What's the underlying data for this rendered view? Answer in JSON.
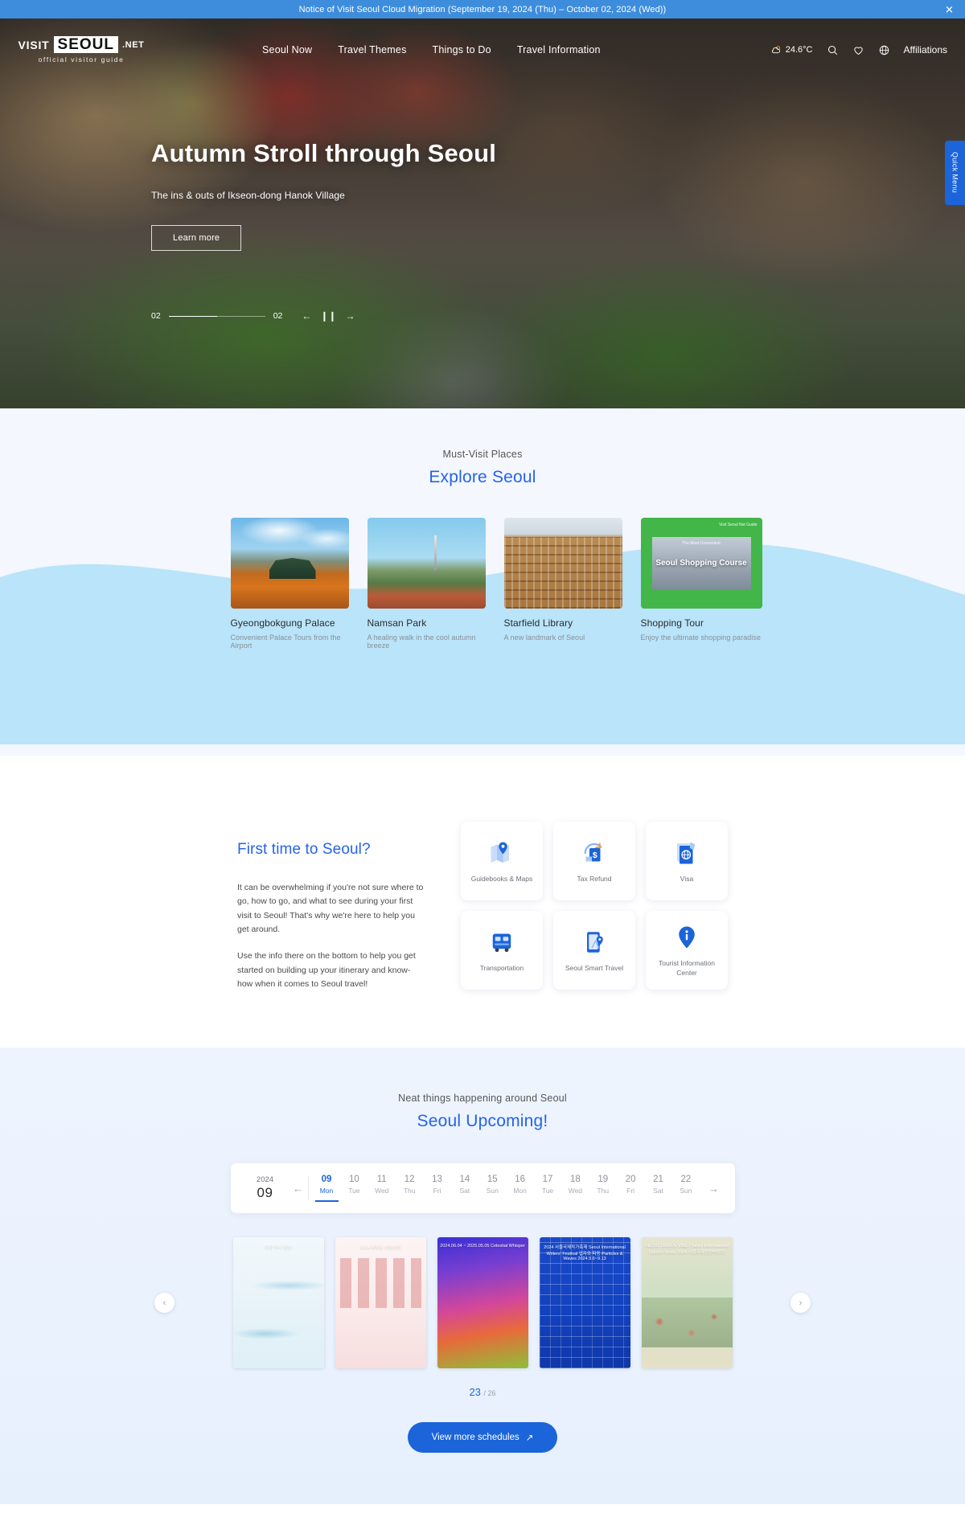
{
  "notice": {
    "text": "Notice of Visit Seoul Cloud Migration (September 19, 2024 (Thu) – October 02, 2024 (Wed))",
    "close_label": "✕"
  },
  "header": {
    "logo": {
      "visit": "VISIT",
      "seoul": "SEOUL",
      "net": ".NET",
      "tagline": "official visitor guide"
    },
    "nav": [
      {
        "label": "Seoul Now"
      },
      {
        "label": "Travel Themes"
      },
      {
        "label": "Things to Do"
      },
      {
        "label": "Travel Information"
      }
    ],
    "weather": "24.6°C",
    "affiliations": "Affiliations",
    "icons": [
      "weather-icon",
      "search-icon",
      "heart-icon",
      "globe-icon"
    ]
  },
  "quick_menu": {
    "label": "Quick Menu"
  },
  "hero": {
    "title": "Autumn Stroll through Seoul",
    "subtitle": "The ins & outs of Ikseon-dong Hanok Village",
    "button": "Learn more",
    "slide_current": "02",
    "slide_total": "02"
  },
  "explore": {
    "eyebrow": "Must-Visit Places",
    "title": "Explore Seoul",
    "cards": [
      {
        "title": "Gyeongbokgung Palace",
        "desc": "Convenient Palace Tours from the Airport"
      },
      {
        "title": "Namsan Park",
        "desc": "A healing walk in the cool autumn breeze"
      },
      {
        "title": "Starfield Library",
        "desc": "A new landmark of Seoul"
      },
      {
        "title": "Shopping Tour",
        "desc": "Enjoy the ultimate shopping paradise",
        "overlay_label": "Seoul Shopping Course",
        "overlay_top": "The Most Convenient",
        "badge": "Visit Seoul\nNet Guide"
      }
    ]
  },
  "firsttime": {
    "title": "First time to Seoul?",
    "paragraph1": "It can be overwhelming if you're not sure where to go, how to go, and what to see during your first visit to Seoul! That's why we're here to help you get around.",
    "paragraph2": "Use the info there on the bottom to help you get started on building up your itinerary and know-how when it comes to Seoul travel!",
    "items": [
      {
        "label": "Guidebooks & Maps",
        "icon": "map-pin-icon"
      },
      {
        "label": "Tax Refund",
        "icon": "tax-refund-icon"
      },
      {
        "label": "Visa",
        "icon": "passport-globe-icon"
      },
      {
        "label": "Transportation",
        "icon": "bus-icon"
      },
      {
        "label": "Seoul Smart Travel",
        "icon": "smartphone-pin-icon"
      },
      {
        "label": "Tourist Information Center",
        "icon": "info-pin-icon"
      }
    ]
  },
  "upcoming": {
    "eyebrow": "Neat things happening around Seoul",
    "title": "Seoul Upcoming!",
    "calendar": {
      "year": "2024",
      "month": "09",
      "prev_arrow": "←",
      "next_arrow": "→",
      "days": [
        {
          "num": "09",
          "label": "Mon",
          "active": true
        },
        {
          "num": "10",
          "label": "Tue",
          "active": false
        },
        {
          "num": "11",
          "label": "Wed",
          "active": false
        },
        {
          "num": "12",
          "label": "Thu",
          "active": false
        },
        {
          "num": "13",
          "label": "Fri",
          "active": false
        },
        {
          "num": "14",
          "label": "Sat",
          "active": false
        },
        {
          "num": "15",
          "label": "Sun",
          "active": false
        },
        {
          "num": "16",
          "label": "Mon",
          "active": false
        },
        {
          "num": "17",
          "label": "Tue",
          "active": false
        },
        {
          "num": "18",
          "label": "Wed",
          "active": false
        },
        {
          "num": "19",
          "label": "Thu",
          "active": false
        },
        {
          "num": "20",
          "label": "Fri",
          "active": false
        },
        {
          "num": "21",
          "label": "Sat",
          "active": false
        },
        {
          "num": "22",
          "label": "Sun",
          "active": false
        }
      ]
    },
    "posters": [
      {
        "caption": "한강 역사 탐방",
        "art": "p1"
      },
      {
        "caption": "2024 태권도 상설공연",
        "art": "p2"
      },
      {
        "caption": "2024.06.04 ~ 2025.05.05 Celestial Whisper",
        "art": "p3"
      },
      {
        "caption": "2024 서울국제작가축제 Seoul International Writers' Festival 입자와 파동 Particles & Waves 2024.9.6~9.13",
        "art": "p4"
      },
      {
        "caption": "SEOUL GREEN VIBE / Seoul International Garden Show 2024 서울국제정원박람회",
        "art": "p5"
      }
    ],
    "prev_arrow": "‹",
    "next_arrow": "›",
    "counter_current": "23",
    "counter_total": "/ 26",
    "more_button": "View more schedules",
    "more_button_arrow": "↗"
  },
  "colors": {
    "accent": "#1b64da",
    "link_blue": "#2563eb",
    "notice_bg": "#3e8ddd",
    "explore_bg": "#f4f7fe",
    "wave_blue": "#b9e4fa"
  }
}
